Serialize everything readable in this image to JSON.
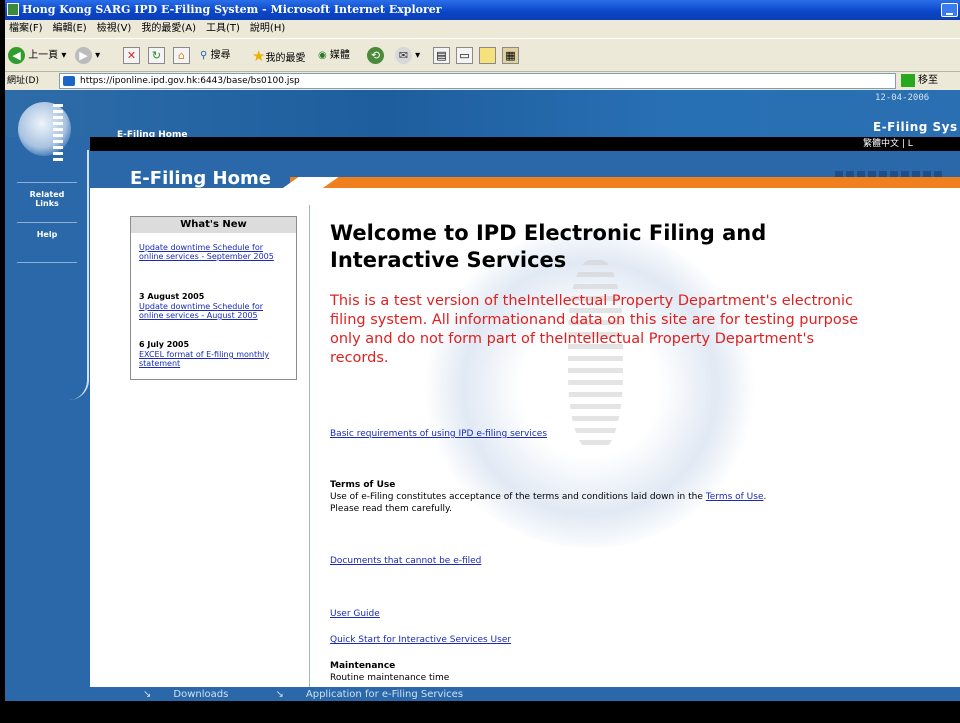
{
  "window": {
    "title": "Hong Kong SARG IPD E-Filing System - Microsoft Internet Explorer"
  },
  "menubar": [
    "檔案(F)",
    "編輯(E)",
    "檢視(V)",
    "我的最愛(A)",
    "工具(T)",
    "說明(H)"
  ],
  "toolbar": {
    "back": "上一頁",
    "search": "搜尋",
    "favorites": "我的最愛",
    "media": "媒體"
  },
  "address": {
    "label": "網址(D)",
    "url": "https://iponline.ipd.gov.hk:6443/base/bs0100.jsp",
    "go": "移至"
  },
  "banner": {
    "date": "12-04-2006",
    "breadcrumb": "E-Filing Home",
    "system": "E-Filing Sys",
    "lang": "繁體中文  |  L"
  },
  "side": {
    "related": "Related Links",
    "help": "Help"
  },
  "page_title": "E-Filing Home",
  "whats_new": {
    "heading": "What's New",
    "items": [
      {
        "date": "",
        "link": "Update downtime Schedule for online services - September 2005"
      },
      {
        "date": "3 August 2005",
        "link": "Update downtime Schedule for online services - August 2005"
      },
      {
        "date": "6 July 2005",
        "link": "EXCEL format of E-filing monthly statement"
      }
    ]
  },
  "main": {
    "welcome": "Welcome to IPD Electronic Filing and Interactive Services",
    "notice": "This is a test version of theIntellectual Property Department's electronic filing system. All informationand data on this site are for testing purpose only and do not form part of theIntellectual Property Department's records.",
    "basic_req": "Basic requirements of using IPD e-filing services",
    "terms_head": "Terms of Use",
    "terms_text": "Use of e-Filing constitutes acceptance of the terms and conditions laid down in the",
    "terms_link": "Terms of Use",
    "terms_text2": "Please read them carefully.",
    "docs": "Documents that cannot be e-filed",
    "guide": "User Guide",
    "quickstart": "Quick Start for Interactive Services User",
    "maint_head": "Maintenance",
    "maint_text": "Routine maintenance time"
  },
  "footer": {
    "downloads": "Downloads",
    "application": "Application for e-Filing Services"
  }
}
